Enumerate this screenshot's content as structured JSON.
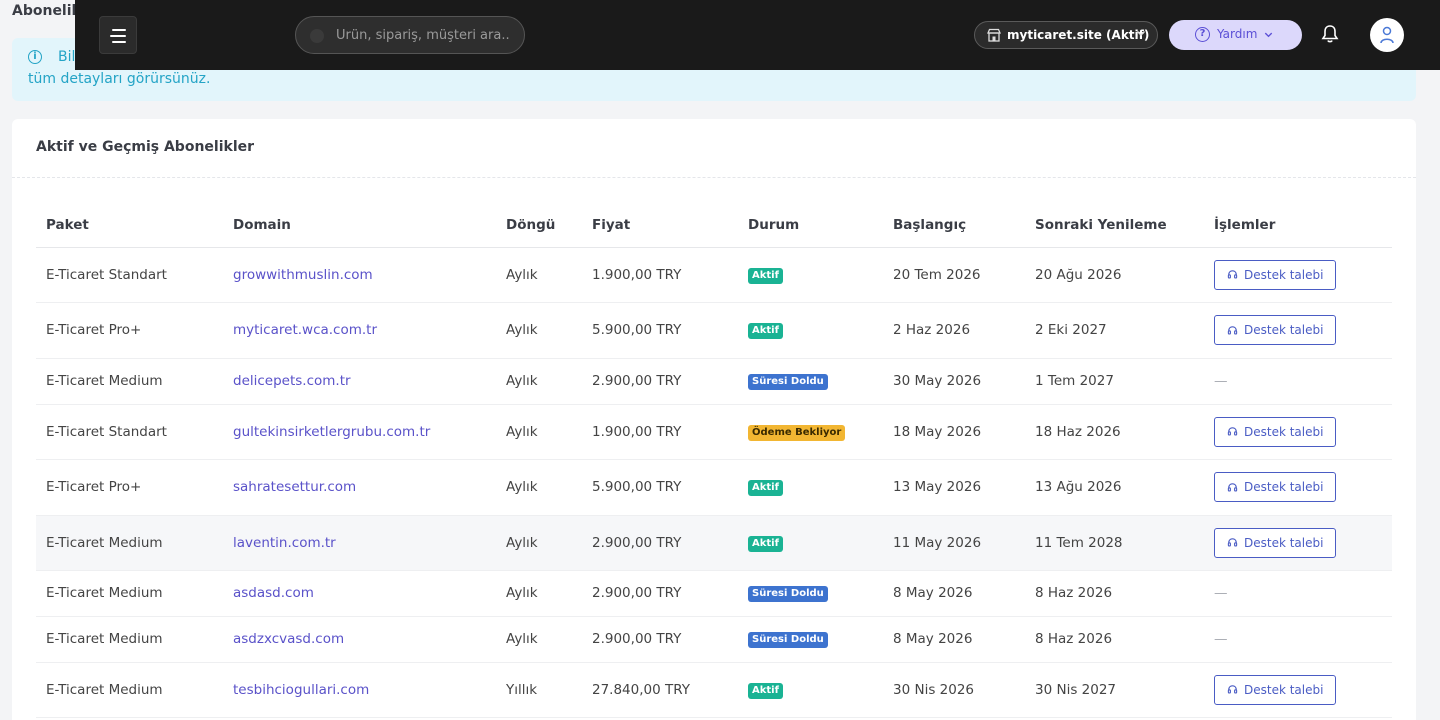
{
  "page": {
    "title": "Abonelikl"
  },
  "info_alert": {
    "line1": "Bil",
    "line2": "tüm detayları görürsünüz."
  },
  "topbar": {
    "search_placeholder": "Ürün, sipariş, müşteri ara..",
    "store_label": "myticaret.site (Aktif)",
    "help_label": "Yardım",
    "icons": [
      "menu-icon",
      "store-icon",
      "chevron-down-icon",
      "question-icon",
      "bell-icon",
      "user-icon"
    ]
  },
  "card": {
    "title": "Aktif ve Geçmiş Abonelikler",
    "columns": [
      "Paket",
      "Domain",
      "Döngü",
      "Fiyat",
      "Durum",
      "Başlangıç",
      "Sonraki Yenileme",
      "İşlemler"
    ],
    "action_label": "Destek talebi",
    "empty_action": "—",
    "rows": [
      {
        "paket": "E-Ticaret Standart",
        "domain": "growwithmuslin.com",
        "dongu": "Aylık",
        "fiyat": "1.900,00 TRY",
        "durum": "Aktif",
        "baslangic": "20 Tem 2026",
        "yenileme": "20 Ağu 2026"
      },
      {
        "paket": "E-Ticaret Pro+",
        "domain": "myticaret.wca.com.tr",
        "dongu": "Aylık",
        "fiyat": "5.900,00 TRY",
        "durum": "Aktif",
        "baslangic": "2 Haz 2026",
        "yenileme": "2 Eki 2027"
      },
      {
        "paket": "E-Ticaret Medium",
        "domain": "delicepets.com.tr",
        "dongu": "Aylık",
        "fiyat": "2.900,00 TRY",
        "durum": "Süresi Doldu",
        "baslangic": "30 May 2026",
        "yenileme": "1 Tem 2027"
      },
      {
        "paket": "E-Ticaret Standart",
        "domain": "gultekinsirketlergrubu.com.tr",
        "dongu": "Aylık",
        "fiyat": "1.900,00 TRY",
        "durum": "Ödeme Bekliyor",
        "baslangic": "18 May 2026",
        "yenileme": "18 Haz 2026"
      },
      {
        "paket": "E-Ticaret Pro+",
        "domain": "sahratesettur.com",
        "dongu": "Aylık",
        "fiyat": "5.900,00 TRY",
        "durum": "Aktif",
        "baslangic": "13 May 2026",
        "yenileme": "13 Ağu 2026"
      },
      {
        "paket": "E-Ticaret Medium",
        "domain": "laventin.com.tr",
        "dongu": "Aylık",
        "fiyat": "2.900,00 TRY",
        "durum": "Aktif",
        "baslangic": "11 May 2026",
        "yenileme": "11 Tem 2028"
      },
      {
        "paket": "E-Ticaret Medium",
        "domain": "asdasd.com",
        "dongu": "Aylık",
        "fiyat": "2.900,00 TRY",
        "durum": "Süresi Doldu",
        "baslangic": "8 May 2026",
        "yenileme": "8 Haz 2026"
      },
      {
        "paket": "E-Ticaret Medium",
        "domain": "asdzxcvasd.com",
        "dongu": "Aylık",
        "fiyat": "2.900,00 TRY",
        "durum": "Süresi Doldu",
        "baslangic": "8 May 2026",
        "yenileme": "8 Haz 2026"
      },
      {
        "paket": "E-Ticaret Medium",
        "domain": "tesbihciogullari.com",
        "dongu": "Yıllık",
        "fiyat": "27.840,00 TRY",
        "durum": "Aktif",
        "baslangic": "30 Nis 2026",
        "yenileme": "30 Nis 2027"
      }
    ]
  },
  "colors": {
    "topbar_bg": "#1a1a1a",
    "status_active": "#1ab394",
    "status_expired": "#3d73cf",
    "status_pending": "#f2b632",
    "link": "#5a52c9",
    "info_bg": "#e2f5fb",
    "info_text": "#24a4c6"
  }
}
